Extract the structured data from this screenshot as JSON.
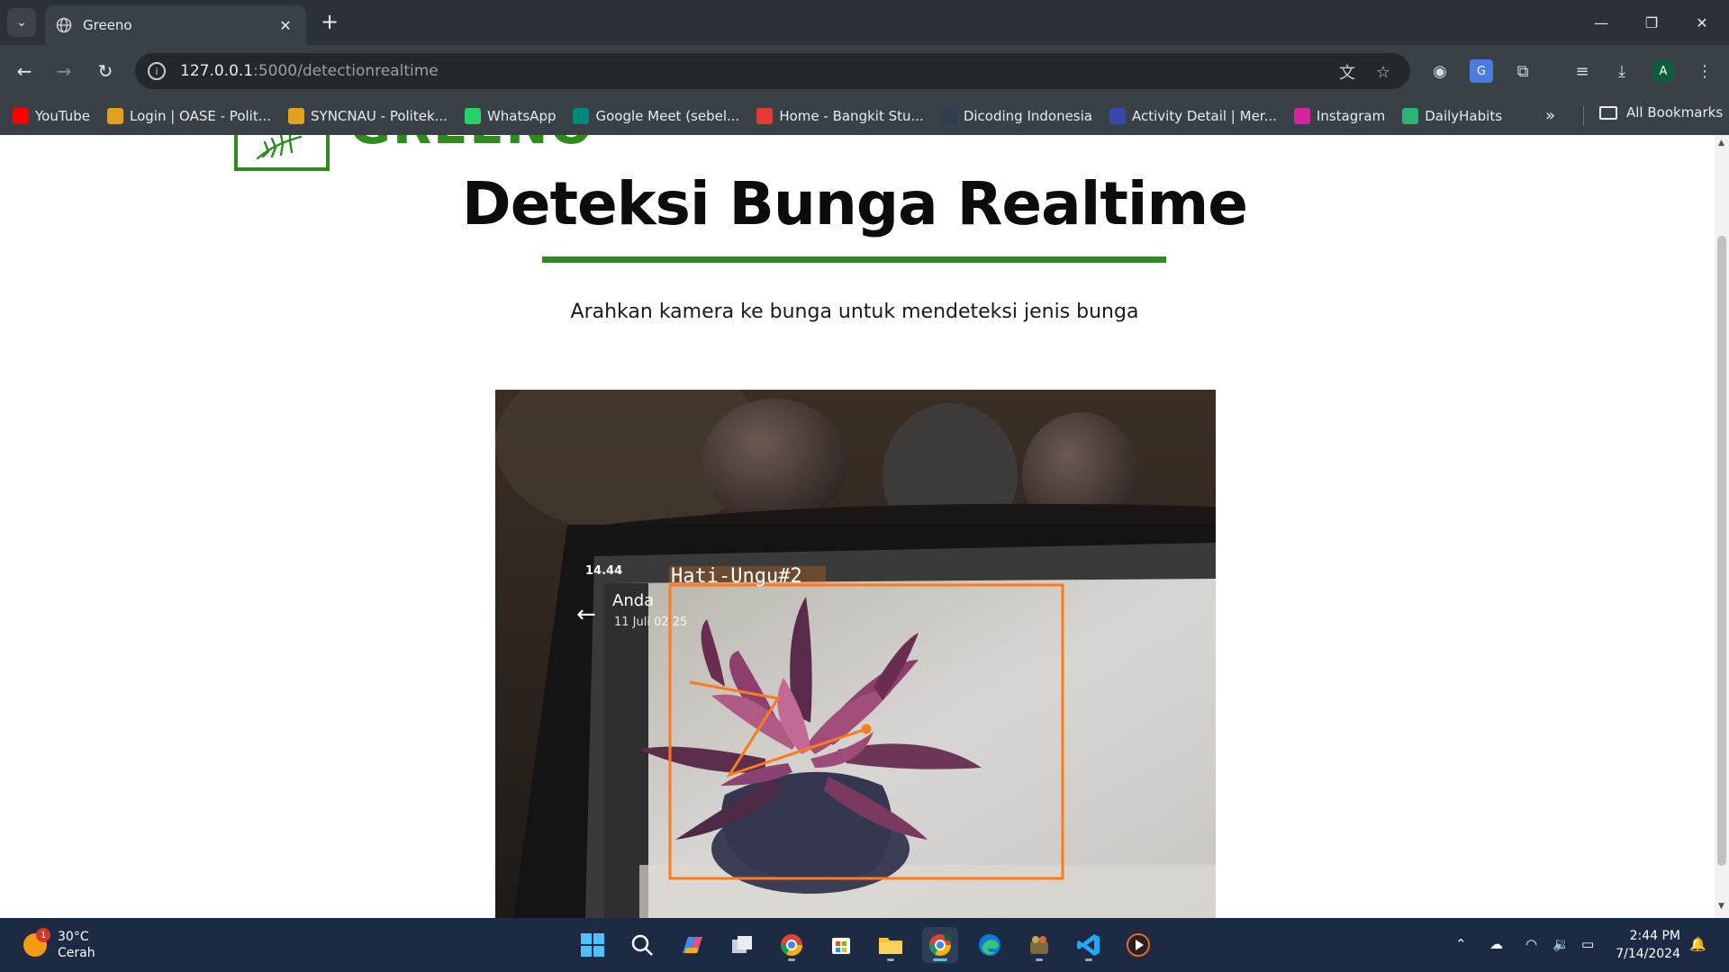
{
  "browser": {
    "tab_title": "Greeno",
    "url_host": "127.0.0.1",
    "url_path": ":5000/detectionrealtime",
    "profile_initial": "A",
    "bookmarks": [
      {
        "label": "YouTube",
        "icon": "youtube-icon",
        "color": "#ff0000"
      },
      {
        "label": "Login | OASE - Polit...",
        "icon": "hexagon-icon",
        "color": "#e0a21a"
      },
      {
        "label": "SYNCNAU - Politek...",
        "icon": "hexagon-icon",
        "color": "#e0a21a"
      },
      {
        "label": "WhatsApp",
        "icon": "whatsapp-icon",
        "color": "#25d366"
      },
      {
        "label": "Google Meet (sebel...",
        "icon": "meet-icon",
        "color": "#00897b"
      },
      {
        "label": "Home - Bangkit Stu...",
        "icon": "bangkit-icon",
        "color": "#e53935"
      },
      {
        "label": "Dicoding Indonesia",
        "icon": "dicoding-icon",
        "color": "#2c3e50"
      },
      {
        "label": "Activity Detail | Mer...",
        "icon": "merdeka-icon",
        "color": "#3949ab"
      },
      {
        "label": "Instagram",
        "icon": "instagram-icon",
        "color": "#d6249f"
      },
      {
        "label": "DailyHabits",
        "icon": "check-icon",
        "color": "#2bb673"
      }
    ],
    "all_bookmarks_label": "All Bookmarks"
  },
  "page": {
    "logo_text": "GREENO",
    "title": "Deteksi Bunga Realtime",
    "subtitle": "Arahkan kamera ke bunga untuk mendeteksi jenis bunga",
    "accent_color": "#2f8b1c"
  },
  "camera": {
    "phone_time": "14.44",
    "phone_contact": "Anda",
    "phone_date": "11 Juli 02.25",
    "detection_label": "Hati-Ungu#2",
    "detection_color": "#ff7a1a"
  },
  "taskbar": {
    "weather_temp": "30°C",
    "weather_desc": "Cerah",
    "weather_badge": "1",
    "time": "2:44 PM",
    "date": "7/14/2024"
  }
}
